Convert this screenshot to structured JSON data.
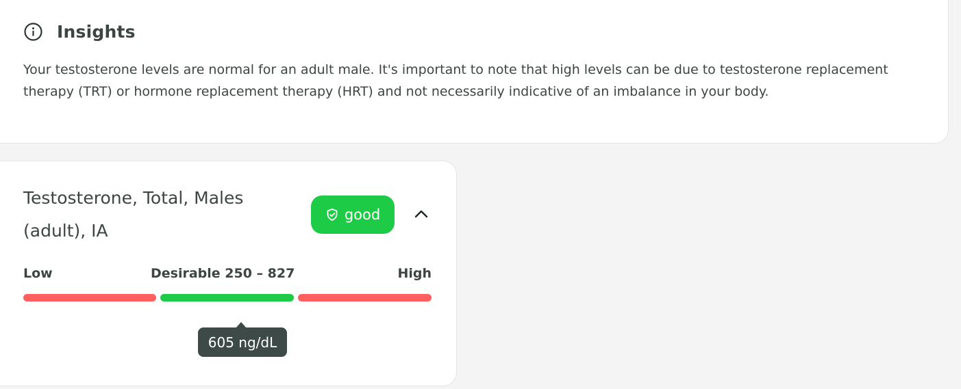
{
  "insights": {
    "icon": "info-icon",
    "title": "Insights",
    "text": "Your testosterone levels are normal for an adult male. It's important to note that high levels can be due to testosterone replacement therapy (TRT) or hormone replacement therapy (HRT) and not necessarily indicative of an imbalance in your body."
  },
  "marker": {
    "name": "Testosterone, Total, Males (adult), IA",
    "status": {
      "icon": "shield-check-icon",
      "label": "good",
      "color": "#1ecb47"
    },
    "collapse_icon": "chevron-up-icon",
    "ranges": {
      "low_label": "Low",
      "desirable_label": "Desirable 250 – 827",
      "high_label": "High",
      "colors": {
        "low": "#ff5f5f",
        "desirable": "#1ecb47",
        "high": "#ff5f5f"
      }
    },
    "value": {
      "display": "605 ng/dL",
      "numeric": 605,
      "unit": "ng/dL"
    }
  }
}
